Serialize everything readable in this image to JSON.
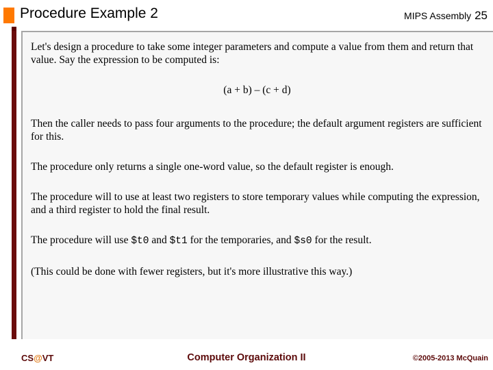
{
  "header": {
    "title": "Procedure Example 2",
    "subject": "MIPS Assembly",
    "slide_number": "25",
    "accent_orange": "#FF7900",
    "accent_maroon": "#6B0D0D"
  },
  "content": {
    "paragraphs": [
      "Let's design a procedure to take some integer parameters and compute a  value from them and return that value.  Say the expression to be computed is:",
      "Then the caller needs to pass four arguments to the procedure; the default argument registers are sufficient for this.",
      "The procedure only returns a single one-word value, so the default register is enough.",
      "The procedure will to use at least two registers to store temporary values while computing the expression, and a third register to hold the final result.",
      "(This could be done with fewer registers, but it's more illustrative this way.)"
    ],
    "formula": "(a + b) – (c + d)",
    "register_sentence": {
      "part1": "The procedure will use ",
      "reg1": "$t0",
      "part2": " and ",
      "reg2": "$t1",
      "part3": " for the temporaries, and ",
      "reg3": "$s0",
      "part4": " for the result."
    }
  },
  "footer": {
    "logo_prefix": "CS",
    "logo_at": "@",
    "logo_suffix": "VT",
    "course": "Computer Organization II",
    "copyright": "©2005-2013 McQuain",
    "color": "#5C0A0A",
    "at_color": "#E07B18"
  }
}
